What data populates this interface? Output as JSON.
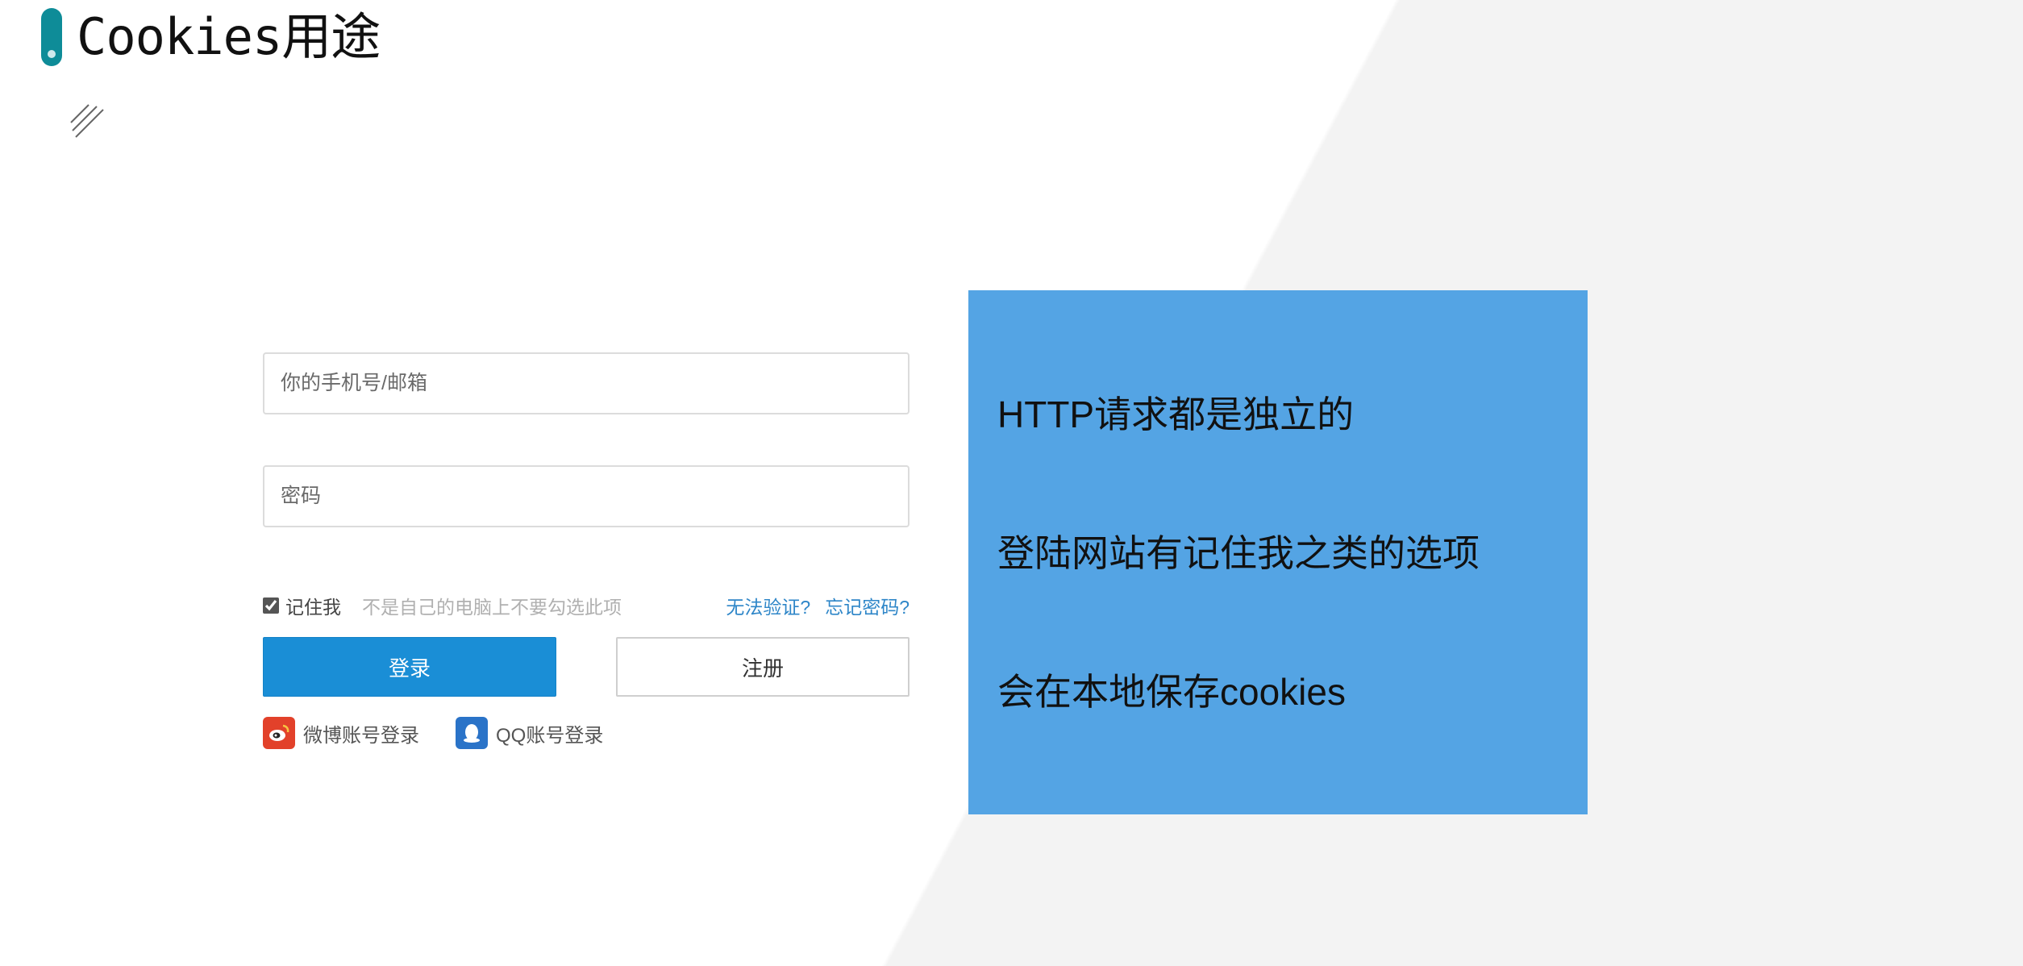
{
  "slide": {
    "title": "Cookies用途"
  },
  "login_form": {
    "phone_placeholder": "你的手机号/邮箱",
    "password_placeholder": "密码",
    "remember_label": "记住我",
    "remember_hint": "不是自己的电脑上不要勾选此项",
    "remember_checked": true,
    "cannot_verify_link": "无法验证?",
    "forgot_password_link": "忘记密码?",
    "login_button": "登录",
    "register_button": "注册",
    "weibo_login": "微博账号登录",
    "qq_login": "QQ账号登录"
  },
  "info_panel": {
    "lines": [
      "HTTP请求都是独立的",
      "登陆网站有记住我之类的选项",
      "会在本地保存cookies"
    ]
  },
  "colors": {
    "accent_teal": "#0e8c98",
    "panel_blue": "#54a4e4",
    "login_blue": "#1a8ed6",
    "link_blue": "#2e86c8",
    "weibo_red": "#e2412a",
    "qq_blue": "#2a73c8"
  },
  "icons": {
    "title_marker": "pill-marker-icon",
    "hatch": "diagonal-hatch-icon",
    "weibo": "weibo-icon",
    "qq": "qq-icon"
  }
}
